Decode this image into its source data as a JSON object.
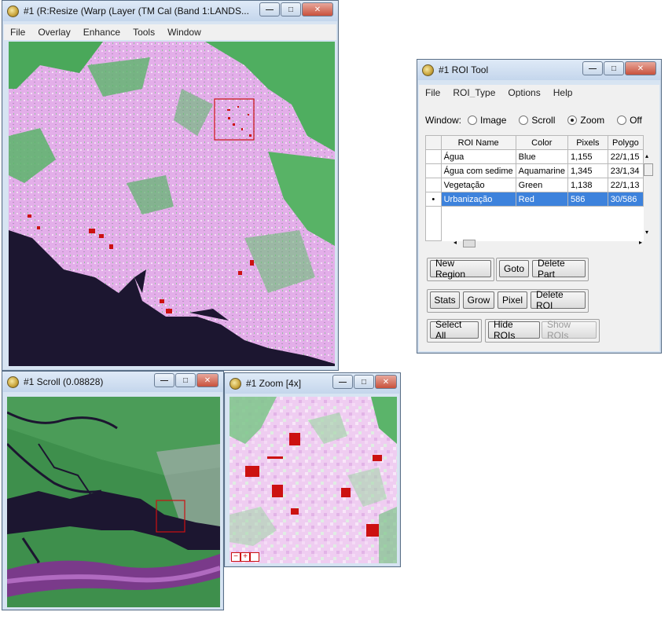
{
  "image_window": {
    "title": "#1 (R:Resize (Warp (Layer (TM Cal (Band 1:LANDS...",
    "menu": [
      "File",
      "Overlay",
      "Enhance",
      "Tools",
      "Window"
    ]
  },
  "roi_tool": {
    "title": "#1 ROI Tool",
    "menu": [
      "File",
      "ROI_Type",
      "Options",
      "Help"
    ],
    "window_label": "Window:",
    "window_options": [
      "Image",
      "Scroll",
      "Zoom",
      "Off"
    ],
    "window_selected": "Zoom",
    "columns": [
      "ROI Name",
      "Color",
      "Pixels",
      "Polygo"
    ],
    "rows": [
      {
        "name": "Água",
        "color": "Blue",
        "pixels": "1,155",
        "polygons": "22/1,15"
      },
      {
        "name": "Água com sedime",
        "color": "Aquamarine",
        "pixels": "1,345",
        "polygons": "23/1,34"
      },
      {
        "name": "Vegetação",
        "color": "Green",
        "pixels": "1,138",
        "polygons": "22/1,13"
      },
      {
        "name": "Urbanização",
        "color": "Red",
        "pixels": "586",
        "polygons": "30/586"
      }
    ],
    "selected_row": 3,
    "buttons": {
      "new_region": "New Region",
      "goto": "Goto",
      "delete_part": "Delete Part",
      "stats": "Stats",
      "grow": "Grow",
      "pixel": "Pixel",
      "delete_roi": "Delete ROI",
      "select_all": "Select All",
      "hide_rois": "Hide ROIs",
      "show_rois": "Show ROIs"
    }
  },
  "scroll_window": {
    "title": "#1 Scroll (0.08828)"
  },
  "zoom_window": {
    "title": "#1 Zoom [4x]"
  },
  "colors": {
    "roi_red": "#cc1111",
    "urban_pink": "#e6b6ea",
    "vegetation": "#4aa85a",
    "water": "#1c1630"
  }
}
